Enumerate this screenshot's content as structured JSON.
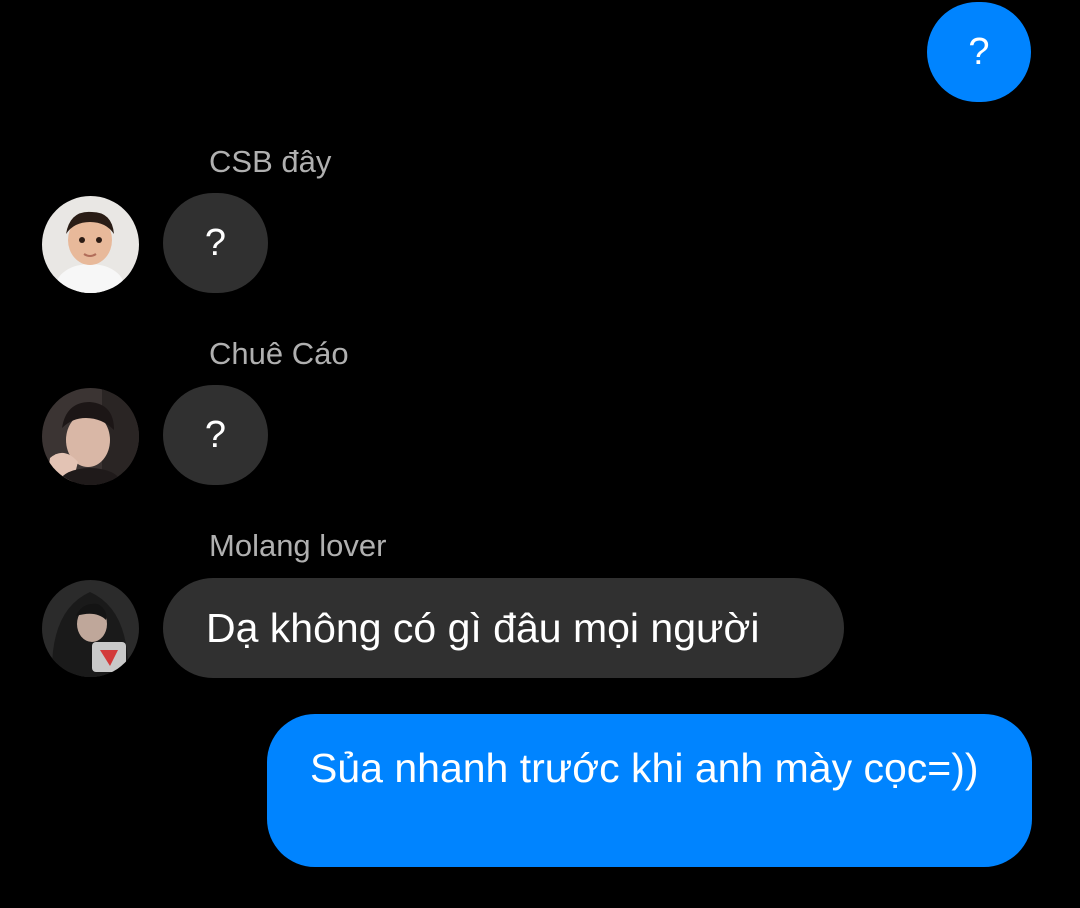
{
  "messages": [
    {
      "direction": "outgoing",
      "text": "?"
    },
    {
      "direction": "incoming",
      "sender": "CSB đây",
      "avatar_icon": "child-avatar-icon",
      "text": "?"
    },
    {
      "direction": "incoming",
      "sender": "Chuê Cáo",
      "avatar_icon": "person-avatar-icon",
      "text": "?"
    },
    {
      "direction": "incoming",
      "sender": "Molang lover",
      "avatar_icon": "hooded-person-avatar-icon",
      "text": "Dạ không có gì đâu mọi người"
    },
    {
      "direction": "outgoing",
      "text": "Sủa nhanh trước khi anh mày cọc=))"
    }
  ],
  "colors": {
    "background": "#000000",
    "outgoing_bubble": "#0084ff",
    "incoming_bubble": "#303030",
    "sender_name": "#b0b0b0"
  }
}
